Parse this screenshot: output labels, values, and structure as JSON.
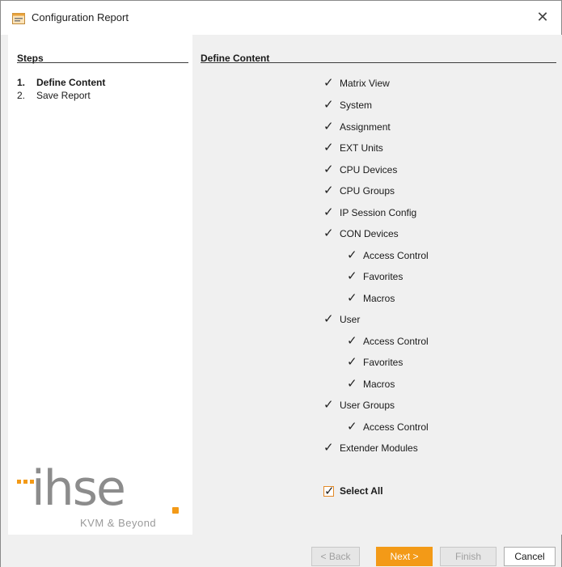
{
  "window": {
    "title": "Configuration Report",
    "close_glyph": "✕"
  },
  "steps": {
    "heading": "Steps",
    "items": [
      {
        "num": "1.",
        "label": "Define Content"
      },
      {
        "num": "2.",
        "label": "Save Report"
      }
    ]
  },
  "content": {
    "heading": "Define Content",
    "options": [
      "Matrix View",
      "System",
      "Assignment",
      "EXT Units",
      "CPU Devices",
      "CPU Groups",
      "IP Session Config",
      "CON Devices",
      "Access Control",
      "Favorites",
      "Macros",
      "User",
      "Access Control",
      "Favorites",
      "Macros",
      "User Groups",
      "Access Control",
      "Extender Modules"
    ],
    "select_all": "Select All"
  },
  "logo": {
    "word": "ihse",
    "tagline": "KVM & Beyond"
  },
  "buttons": {
    "back": "< Back",
    "next": "Next >",
    "finish": "Finish",
    "cancel": "Cancel"
  },
  "colors": {
    "accent": "#f39a17",
    "logo_gray": "#8c8c8c"
  },
  "icons": {
    "app": "report-icon",
    "close": "close-icon",
    "check": "checkmark-icon"
  }
}
